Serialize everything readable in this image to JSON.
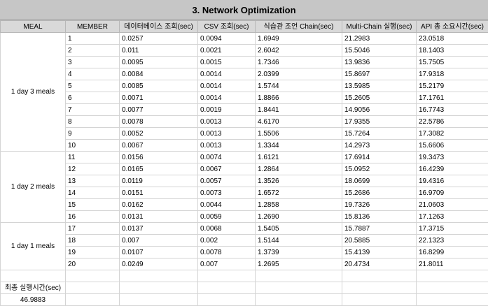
{
  "title": "3.  Network Optimization",
  "headers": [
    "MEAL",
    "MEMBER",
    "데이터베이스 조회(sec)",
    "CSV 조회(sec)",
    "식습관 조언 Chain(sec)",
    "Multi-Chain 실행(sec)",
    "API 총 소요시간(sec)"
  ],
  "groups": [
    {
      "meal": "1 day 3 meals",
      "rows": [
        [
          "1",
          "0.0257",
          "0.0094",
          "1.6949",
          "21.2983",
          "23.0518"
        ],
        [
          "2",
          "0.011",
          "0.0021",
          "2.6042",
          "15.5046",
          "18.1403"
        ],
        [
          "3",
          "0.0095",
          "0.0015",
          "1.7346",
          "13.9836",
          "15.7505"
        ],
        [
          "4",
          "0.0084",
          "0.0014",
          "2.0399",
          "15.8697",
          "17.9318"
        ],
        [
          "5",
          "0.0085",
          "0.0014",
          "1.5744",
          "13.5985",
          "15.2179"
        ],
        [
          "6",
          "0.0071",
          "0.0014",
          "1.8866",
          "15.2605",
          "17.1761"
        ],
        [
          "7",
          "0.0077",
          "0.0019",
          "1.8441",
          "14.9056",
          "16.7743"
        ],
        [
          "8",
          "0.0078",
          "0.0013",
          "4.6170",
          "17.9355",
          "22.5786"
        ],
        [
          "9",
          "0.0052",
          "0.0013",
          "1.5506",
          "15.7264",
          "17.3082"
        ],
        [
          "10",
          "0.0067",
          "0.0013",
          "1.3344",
          "14.2973",
          "15.6606"
        ]
      ]
    },
    {
      "meal": "1 day 2 meals",
      "rows": [
        [
          "11",
          "0.0156",
          "0.0074",
          "1.6121",
          "17.6914",
          "19.3473"
        ],
        [
          "12",
          "0.0165",
          "0.0067",
          "1.2864",
          "15.0952",
          "16.4239"
        ],
        [
          "13",
          "0.0119",
          "0.0057",
          "1.3526",
          "18.0699",
          "19.4316"
        ],
        [
          "14",
          "0.0151",
          "0.0073",
          "1.6572",
          "15.2686",
          "16.9709"
        ],
        [
          "15",
          "0.0162",
          "0.0044",
          "1.2858",
          "19.7326",
          "21.0603"
        ],
        [
          "16",
          "0.0131",
          "0.0059",
          "1.2690",
          "15.8136",
          "17.1263"
        ]
      ]
    },
    {
      "meal": "1 day 1 meals",
      "rows": [
        [
          "17",
          "0.0137",
          "0.0068",
          "1.5405",
          "15.7887",
          "17.3715"
        ],
        [
          "18",
          "0.007",
          "0.002",
          "1.5144",
          "20.5885",
          "22.1323"
        ],
        [
          "19",
          "0.0107",
          "0.0078",
          "1.3739",
          "15.4139",
          "16.8299"
        ],
        [
          "20",
          "0.0249",
          "0.007",
          "1.2695",
          "20.4734",
          "21.8011"
        ]
      ]
    }
  ],
  "total": {
    "label": "최종 실행시간(sec)",
    "value": "46.9883"
  }
}
